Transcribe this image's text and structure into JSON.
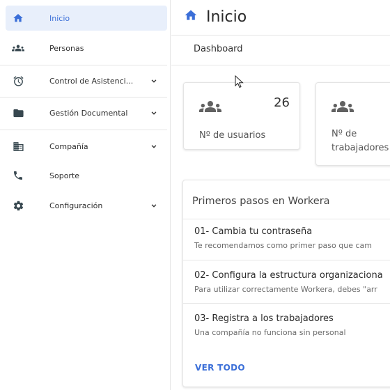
{
  "sidebar": {
    "items": [
      {
        "label": "Inicio",
        "icon": "home-icon",
        "active": true
      },
      {
        "label": "Personas",
        "icon": "people-icon"
      },
      {
        "label": "Control de Asistenci...",
        "icon": "alarm-clock-icon",
        "expandable": true
      },
      {
        "label": "Gestión Documental",
        "icon": "folder-icon",
        "expandable": true
      },
      {
        "label": "Compañía",
        "icon": "building-icon",
        "expandable": true
      },
      {
        "label": "Soporte",
        "icon": "phone-icon"
      },
      {
        "label": "Configuración",
        "icon": "gear-icon",
        "expandable": true
      }
    ]
  },
  "header": {
    "title": "Inicio",
    "breadcrumb": "Dashboard"
  },
  "stats": [
    {
      "label": "Nº de usuarios",
      "count": "26",
      "icon": "people-icon"
    },
    {
      "label": "Nº de trabajadores",
      "icon": "people-icon"
    }
  ],
  "getting_started": {
    "title": "Primeros pasos en Workera",
    "steps": [
      {
        "title": "01- Cambia tu contraseña",
        "description": "Te recomendamos como primer paso que cam"
      },
      {
        "title": "02- Configura la estructura organizaciona",
        "description": "Para utilizar correctamente Workera, debes \"arr"
      },
      {
        "title": "03- Registra a los trabajadores",
        "description": "Una compañía no funciona sin personal"
      }
    ],
    "see_all_label": "VER TODO"
  },
  "colors": {
    "accent": "#3b6fd8",
    "active_bg": "#e8effb",
    "icon_dark": "#37474f"
  }
}
